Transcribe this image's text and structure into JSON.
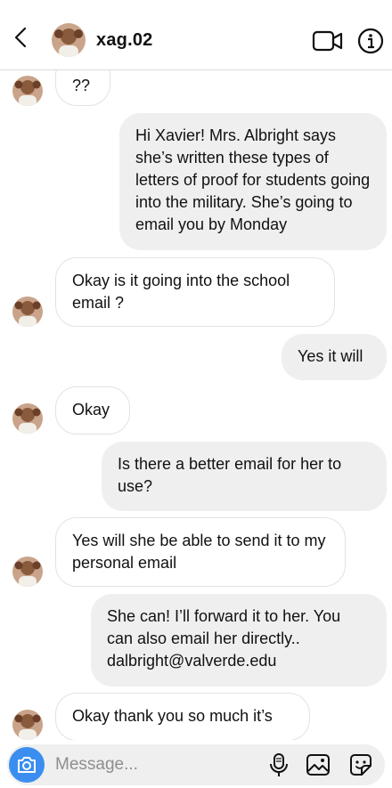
{
  "header": {
    "username": "xag.02"
  },
  "composer": {
    "placeholder": "Message..."
  },
  "messages": [
    {
      "from": "them",
      "text": "??"
    },
    {
      "from": "me",
      "text": "Hi Xavier! Mrs. Albright says she’s written these types of letters of proof for students going into the military. She’s going to email you by Monday"
    },
    {
      "from": "them",
      "text": "Okay is it going into the school email ?"
    },
    {
      "from": "me",
      "text": "Yes it will"
    },
    {
      "from": "them",
      "text": "Okay"
    },
    {
      "from": "me",
      "text": "Is there a better email for her to use?"
    },
    {
      "from": "them",
      "text": "Yes will she be able to send it to my personal email"
    },
    {
      "from": "me",
      "text": "She can! I’ll forward it to her. You can also email her directly.. dalbright@valverde.edu"
    },
    {
      "from": "them",
      "text": "Okay thank you so much it’s"
    }
  ],
  "colors": {
    "sent_bubble": "#efefef",
    "received_border": "#e2e2e2",
    "camera_button": "#3b8ef0"
  }
}
